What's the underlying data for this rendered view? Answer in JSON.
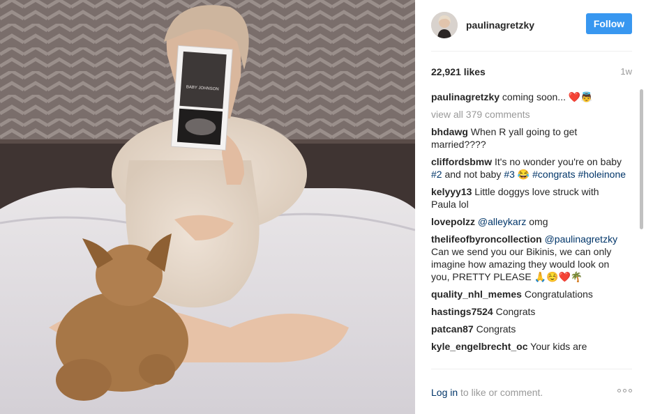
{
  "post": {
    "username": "paulinagretzky",
    "follow_label": "Follow",
    "likes": "22,921 likes",
    "age": "1w",
    "caption": {
      "user": "paulinagretzky",
      "text": "coming soon... ❤️👼"
    },
    "view_all": "view all 379 comments",
    "login_link": "Log in",
    "login_rest": " to like or comment.",
    "photo_card_text": "BABY JOHNSON"
  },
  "comments": [
    {
      "user": "bhdawg",
      "parts": [
        {
          "t": "When R yall going to get married????"
        }
      ]
    },
    {
      "user": "cliffordsbmw",
      "parts": [
        {
          "t": "It's no wonder you're on baby "
        },
        {
          "tag": "#2"
        },
        {
          "t": " and not baby "
        },
        {
          "tag": "#3"
        },
        {
          "t": " 😂 "
        },
        {
          "tag": "#congrats"
        },
        {
          "t": " "
        },
        {
          "tag": "#holeinone"
        }
      ]
    },
    {
      "user": "kelyyy13",
      "parts": [
        {
          "t": "Little doggys love struck with Paula lol"
        }
      ]
    },
    {
      "user": "lovepolzz",
      "parts": [
        {
          "tag": "@alleykarz"
        },
        {
          "t": " omg"
        }
      ]
    },
    {
      "user": "thelifeofbyroncollection",
      "parts": [
        {
          "tag": "@paulinagretzky"
        },
        {
          "t": " Can we send you our Bikinis, we can only imagine how amazing they would look on you, PRETTY PLEASE 🙏☺️❤️🌴"
        }
      ]
    },
    {
      "user": "quality_nhl_memes",
      "parts": [
        {
          "t": "Congratulations"
        }
      ]
    },
    {
      "user": "hastings7524",
      "parts": [
        {
          "t": "Congrats"
        }
      ]
    },
    {
      "user": "patcan87",
      "parts": [
        {
          "t": "Congrats"
        }
      ]
    },
    {
      "user": "kyle_engelbrecht_oc",
      "parts": [
        {
          "t": "Your kids are"
        }
      ]
    }
  ],
  "colors": {
    "accent": "#3897f0",
    "link": "#003569",
    "muted": "#999999"
  }
}
